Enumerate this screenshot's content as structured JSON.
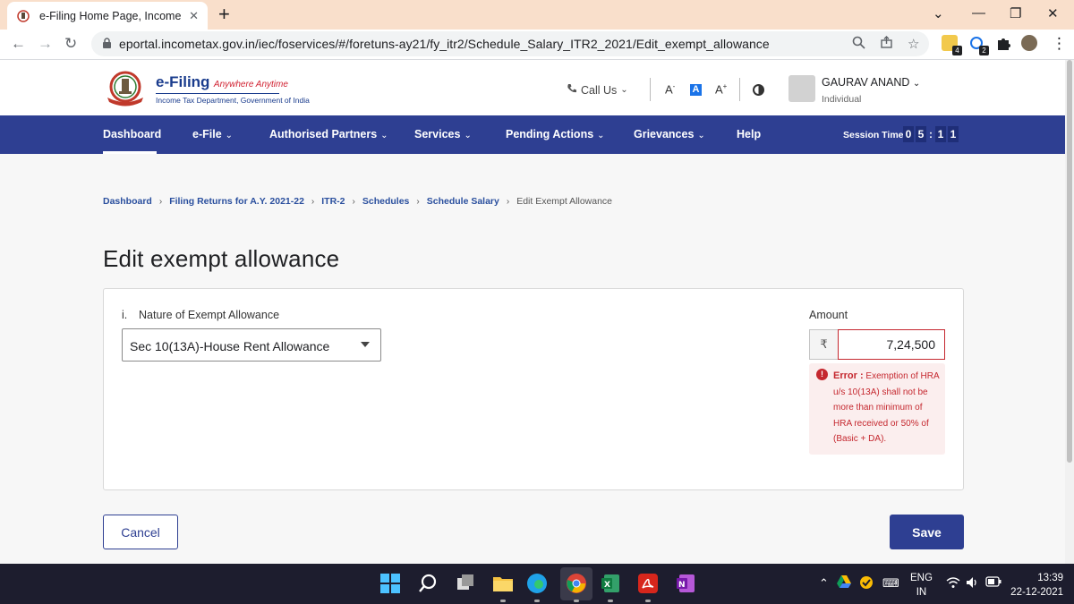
{
  "browser": {
    "tab_title": "e-Filing Home Page, Income Tax I",
    "url": "eportal.incometax.gov.in/iec/foservices/#/foretuns-ay21/fy_itr2/Schedule_Salary_ITR2_2021/Edit_exempt_allowance",
    "ext_badge_1": "4",
    "ext_badge_2": "2"
  },
  "header": {
    "brand_title": "e-Filing",
    "brand_tagline": "Anywhere Anytime",
    "brand_dept": "Income Tax Department, Government of India",
    "call_us": "Call Us",
    "font_small": "A",
    "font_normal": "A",
    "font_large": "A",
    "font_small_sup": "-",
    "font_large_sup": "+",
    "user_name": "GAURAV ANAND",
    "user_role": "Individual"
  },
  "nav": {
    "items": [
      {
        "label": "Dashboard",
        "chevron": ""
      },
      {
        "label": "e-File",
        "chevron": "⌄"
      },
      {
        "label": "Authorised Partners",
        "chevron": "⌄"
      },
      {
        "label": "Services",
        "chevron": "⌄"
      },
      {
        "label": "Pending Actions",
        "chevron": "⌄"
      },
      {
        "label": "Grievances",
        "chevron": "⌄"
      },
      {
        "label": "Help",
        "chevron": ""
      }
    ],
    "session_label": "Session Time",
    "session_digits": [
      "0",
      "5",
      "1",
      "1"
    ],
    "colon": ":"
  },
  "breadcrumb": [
    "Dashboard",
    "Filing Returns for A.Y. 2021-22",
    "ITR-2",
    "Schedules",
    "Schedule Salary",
    "Edit Exempt Allowance"
  ],
  "page": {
    "title": "Edit exempt allowance",
    "field_number": "i.",
    "field_label": "Nature of Exempt Allowance",
    "field_value": "Sec 10(13A)-House Rent Allowance",
    "amount_label": "Amount",
    "currency_symbol": "₹",
    "amount_value": "7,24,500",
    "error_prefix": "Error :",
    "error_message": "Exemption of HRA u/s 10(13A) shall not be more than minimum of HRA received or 50% of (Basic + DA).",
    "cancel_label": "Cancel",
    "save_label": "Save"
  },
  "taskbar": {
    "lang_1": "ENG",
    "lang_2": "IN",
    "time": "13:39",
    "date": "22-12-2021"
  },
  "colors": {
    "nav_bg": "#2e3f92",
    "error_red": "#c5282f",
    "tab_strip": "#f9dfcb"
  }
}
